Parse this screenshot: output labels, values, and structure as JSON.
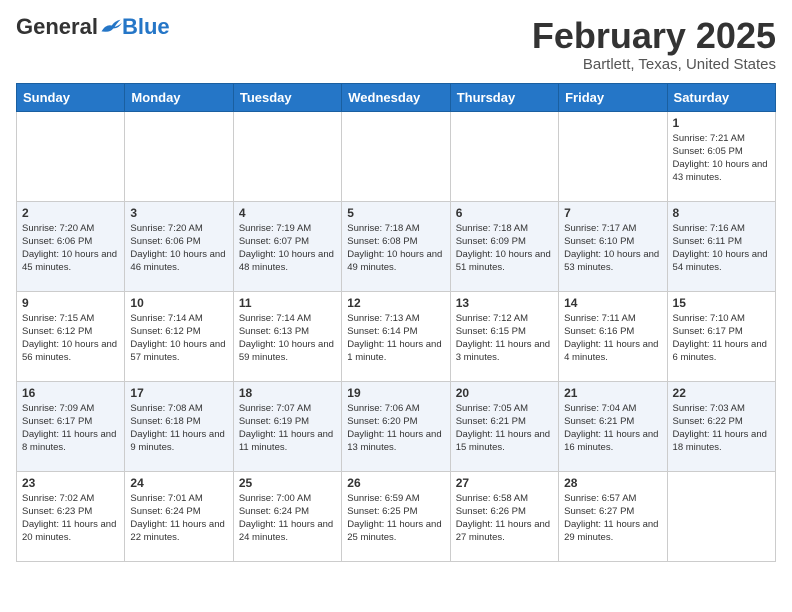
{
  "header": {
    "logo_general": "General",
    "logo_blue": "Blue",
    "month_title": "February 2025",
    "location": "Bartlett, Texas, United States"
  },
  "weekdays": [
    "Sunday",
    "Monday",
    "Tuesday",
    "Wednesday",
    "Thursday",
    "Friday",
    "Saturday"
  ],
  "weeks": [
    [
      {
        "day": "",
        "info": ""
      },
      {
        "day": "",
        "info": ""
      },
      {
        "day": "",
        "info": ""
      },
      {
        "day": "",
        "info": ""
      },
      {
        "day": "",
        "info": ""
      },
      {
        "day": "",
        "info": ""
      },
      {
        "day": "1",
        "info": "Sunrise: 7:21 AM\nSunset: 6:05 PM\nDaylight: 10 hours and 43 minutes."
      }
    ],
    [
      {
        "day": "2",
        "info": "Sunrise: 7:20 AM\nSunset: 6:06 PM\nDaylight: 10 hours and 45 minutes."
      },
      {
        "day": "3",
        "info": "Sunrise: 7:20 AM\nSunset: 6:06 PM\nDaylight: 10 hours and 46 minutes."
      },
      {
        "day": "4",
        "info": "Sunrise: 7:19 AM\nSunset: 6:07 PM\nDaylight: 10 hours and 48 minutes."
      },
      {
        "day": "5",
        "info": "Sunrise: 7:18 AM\nSunset: 6:08 PM\nDaylight: 10 hours and 49 minutes."
      },
      {
        "day": "6",
        "info": "Sunrise: 7:18 AM\nSunset: 6:09 PM\nDaylight: 10 hours and 51 minutes."
      },
      {
        "day": "7",
        "info": "Sunrise: 7:17 AM\nSunset: 6:10 PM\nDaylight: 10 hours and 53 minutes."
      },
      {
        "day": "8",
        "info": "Sunrise: 7:16 AM\nSunset: 6:11 PM\nDaylight: 10 hours and 54 minutes."
      }
    ],
    [
      {
        "day": "9",
        "info": "Sunrise: 7:15 AM\nSunset: 6:12 PM\nDaylight: 10 hours and 56 minutes."
      },
      {
        "day": "10",
        "info": "Sunrise: 7:14 AM\nSunset: 6:12 PM\nDaylight: 10 hours and 57 minutes."
      },
      {
        "day": "11",
        "info": "Sunrise: 7:14 AM\nSunset: 6:13 PM\nDaylight: 10 hours and 59 minutes."
      },
      {
        "day": "12",
        "info": "Sunrise: 7:13 AM\nSunset: 6:14 PM\nDaylight: 11 hours and 1 minute."
      },
      {
        "day": "13",
        "info": "Sunrise: 7:12 AM\nSunset: 6:15 PM\nDaylight: 11 hours and 3 minutes."
      },
      {
        "day": "14",
        "info": "Sunrise: 7:11 AM\nSunset: 6:16 PM\nDaylight: 11 hours and 4 minutes."
      },
      {
        "day": "15",
        "info": "Sunrise: 7:10 AM\nSunset: 6:17 PM\nDaylight: 11 hours and 6 minutes."
      }
    ],
    [
      {
        "day": "16",
        "info": "Sunrise: 7:09 AM\nSunset: 6:17 PM\nDaylight: 11 hours and 8 minutes."
      },
      {
        "day": "17",
        "info": "Sunrise: 7:08 AM\nSunset: 6:18 PM\nDaylight: 11 hours and 9 minutes."
      },
      {
        "day": "18",
        "info": "Sunrise: 7:07 AM\nSunset: 6:19 PM\nDaylight: 11 hours and 11 minutes."
      },
      {
        "day": "19",
        "info": "Sunrise: 7:06 AM\nSunset: 6:20 PM\nDaylight: 11 hours and 13 minutes."
      },
      {
        "day": "20",
        "info": "Sunrise: 7:05 AM\nSunset: 6:21 PM\nDaylight: 11 hours and 15 minutes."
      },
      {
        "day": "21",
        "info": "Sunrise: 7:04 AM\nSunset: 6:21 PM\nDaylight: 11 hours and 16 minutes."
      },
      {
        "day": "22",
        "info": "Sunrise: 7:03 AM\nSunset: 6:22 PM\nDaylight: 11 hours and 18 minutes."
      }
    ],
    [
      {
        "day": "23",
        "info": "Sunrise: 7:02 AM\nSunset: 6:23 PM\nDaylight: 11 hours and 20 minutes."
      },
      {
        "day": "24",
        "info": "Sunrise: 7:01 AM\nSunset: 6:24 PM\nDaylight: 11 hours and 22 minutes."
      },
      {
        "day": "25",
        "info": "Sunrise: 7:00 AM\nSunset: 6:24 PM\nDaylight: 11 hours and 24 minutes."
      },
      {
        "day": "26",
        "info": "Sunrise: 6:59 AM\nSunset: 6:25 PM\nDaylight: 11 hours and 25 minutes."
      },
      {
        "day": "27",
        "info": "Sunrise: 6:58 AM\nSunset: 6:26 PM\nDaylight: 11 hours and 27 minutes."
      },
      {
        "day": "28",
        "info": "Sunrise: 6:57 AM\nSunset: 6:27 PM\nDaylight: 11 hours and 29 minutes."
      },
      {
        "day": "",
        "info": ""
      }
    ]
  ]
}
